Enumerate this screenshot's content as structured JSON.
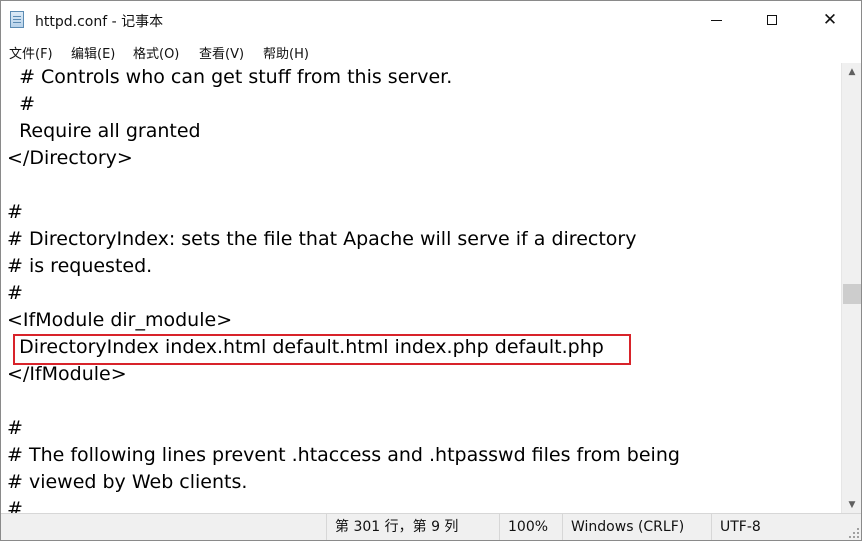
{
  "window": {
    "title": "httpd.conf - 记事本",
    "minimize_glyph": "—",
    "maximize_glyph": "☐",
    "close_glyph": "✕"
  },
  "menubar": {
    "items": [
      "文件(F)",
      "编辑(E)",
      "格式(O)",
      "查看(V)",
      "帮助(H)"
    ]
  },
  "editor": {
    "lines": [
      "  # Controls who can get stuff from this server.",
      "  #",
      "  Require all granted",
      "</Directory>",
      "",
      "#",
      "# DirectoryIndex: sets the file that Apache will serve if a directory",
      "# is requested.",
      "#",
      "<IfModule dir_module>",
      "  DirectoryIndex index.html default.html index.php default.php",
      "</IfModule>",
      "",
      "#",
      "# The following lines prevent .htaccess and .htpasswd files from being",
      "# viewed by Web clients.",
      "#"
    ],
    "highlighted_line_index": 10,
    "highlight_color": "#d8232a"
  },
  "scrollbar": {
    "up_arrow": "▲",
    "down_arrow": "▼"
  },
  "statusbar": {
    "position": "第 301 行，第 9 列",
    "zoom": "100%",
    "line_ending": "Windows (CRLF)",
    "encoding": "UTF-8"
  }
}
